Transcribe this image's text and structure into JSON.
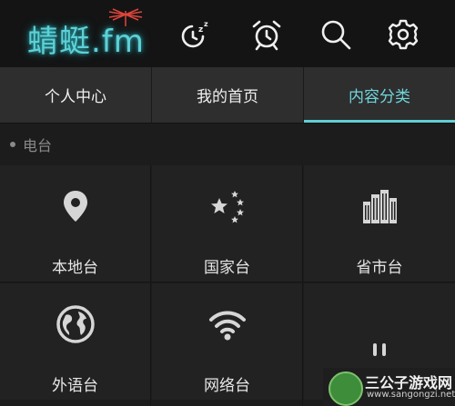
{
  "app": {
    "logo_text": "蜻蜓.fm"
  },
  "toolbar": {
    "icons": [
      "sleep-timer-icon",
      "alarm-clock-icon",
      "search-icon",
      "settings-gear-icon"
    ]
  },
  "tabs": [
    {
      "label": "个人中心",
      "active": false
    },
    {
      "label": "我的首页",
      "active": false
    },
    {
      "label": "内容分类",
      "active": true
    }
  ],
  "section": {
    "title": "电台"
  },
  "categories": [
    {
      "label": "本地台",
      "icon": "location-pin-icon"
    },
    {
      "label": "国家台",
      "icon": "stars-flag-icon"
    },
    {
      "label": "省市台",
      "icon": "city-buildings-icon"
    },
    {
      "label": "外语台",
      "icon": "globe-icon"
    },
    {
      "label": "网络台",
      "icon": "wifi-icon"
    },
    {
      "label": "",
      "icon": "more-icon"
    }
  ],
  "watermark": {
    "title": "三公子游戏网",
    "url": "www.sangongzi.net"
  },
  "colors": {
    "accent": "#5fd0d6",
    "background": "#1c1c1c",
    "topbar": "#141414",
    "tabbar": "#2e2e2e"
  }
}
